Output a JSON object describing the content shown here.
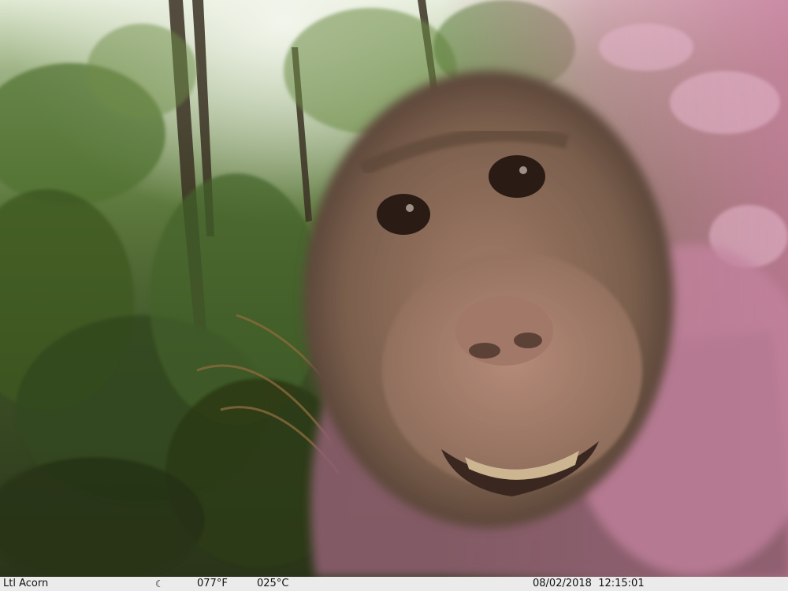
{
  "photo": {
    "subject": "macaque-face",
    "scene": "forest",
    "tint_right": "#c77a9c",
    "foliage": "#4f6f2e",
    "fur": "#6e5644"
  },
  "infobar": {
    "brand": "Ltl Acorn",
    "moon_icon": "☾",
    "temperature_f": "077°F",
    "temperature_c": "025°C",
    "date": "08/02/2018",
    "time": "12:15:01"
  }
}
